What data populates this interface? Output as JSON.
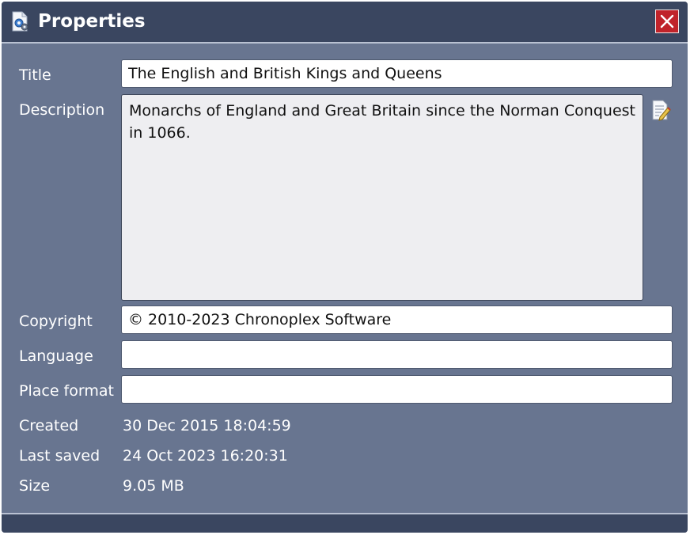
{
  "window": {
    "title": "Properties"
  },
  "form": {
    "title_label": "Title",
    "title_value": "The English and British Kings and Queens",
    "description_label": "Description",
    "description_value": "Monarchs of England and Great Britain since the Norman Conquest in 1066.",
    "copyright_label": "Copyright",
    "copyright_value": "© 2010-2023 Chronoplex Software",
    "language_label": "Language",
    "language_value": "",
    "place_format_label": "Place format",
    "place_format_value": ""
  },
  "info": {
    "created_label": "Created",
    "created_value": "30 Dec 2015 18:04:59",
    "last_saved_label": "Last saved",
    "last_saved_value": "24 Oct 2023 16:20:31",
    "size_label": "Size",
    "size_value": "9.05 MB"
  },
  "colors": {
    "titlebar": "#3a4660",
    "panel": "#687590",
    "close_button": "#c0232a"
  },
  "icons": {
    "app": "document-settings-icon",
    "close": "close-icon",
    "edit": "edit-note-icon"
  }
}
